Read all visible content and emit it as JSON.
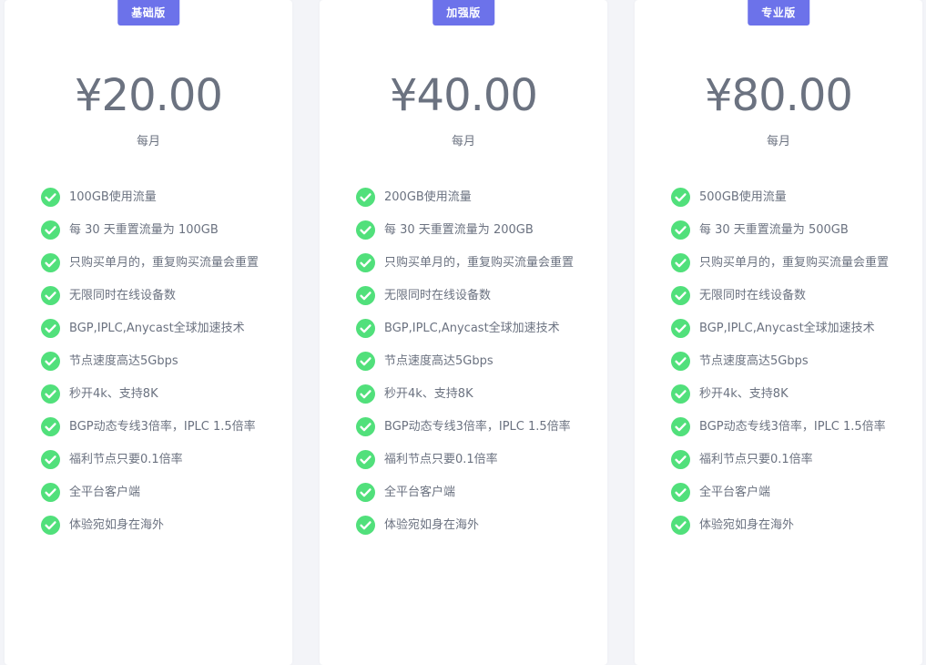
{
  "colors": {
    "badge": "#6c72ea",
    "check": "#51e07b",
    "text": "#6b7280",
    "page_bg": "#f3f4f8",
    "card_bg": "#ffffff"
  },
  "icons": {
    "feature": "check-circle-icon"
  },
  "plans": [
    {
      "badge": "基础版",
      "price": "¥20.00",
      "period": "每月",
      "features": [
        "100GB使用流量",
        "每 30 天重置流量为 100GB",
        "只购买单月的，重复购买流量会重置",
        "无限同时在线设备数",
        "BGP,IPLC,Anycast全球加速技术",
        "节点速度高达5Gbps",
        "秒开4k、支持8K",
        "BGP动态专线3倍率，IPLC 1.5倍率",
        "福利节点只要0.1倍率",
        "全平台客户端",
        "体验宛如身在海外"
      ]
    },
    {
      "badge": "加强版",
      "price": "¥40.00",
      "period": "每月",
      "features": [
        "200GB使用流量",
        "每 30 天重置流量为 200GB",
        "只购买单月的，重复购买流量会重置",
        "无限同时在线设备数",
        "BGP,IPLC,Anycast全球加速技术",
        "节点速度高达5Gbps",
        "秒开4k、支持8K",
        "BGP动态专线3倍率，IPLC 1.5倍率",
        "福利节点只要0.1倍率",
        "全平台客户端",
        "体验宛如身在海外"
      ]
    },
    {
      "badge": "专业版",
      "price": "¥80.00",
      "period": "每月",
      "features": [
        "500GB使用流量",
        "每 30 天重置流量为 500GB",
        "只购买单月的，重复购买流量会重置",
        "无限同时在线设备数",
        "BGP,IPLC,Anycast全球加速技术",
        "节点速度高达5Gbps",
        "秒开4k、支持8K",
        "BGP动态专线3倍率，IPLC 1.5倍率",
        "福利节点只要0.1倍率",
        "全平台客户端",
        "体验宛如身在海外"
      ]
    }
  ]
}
